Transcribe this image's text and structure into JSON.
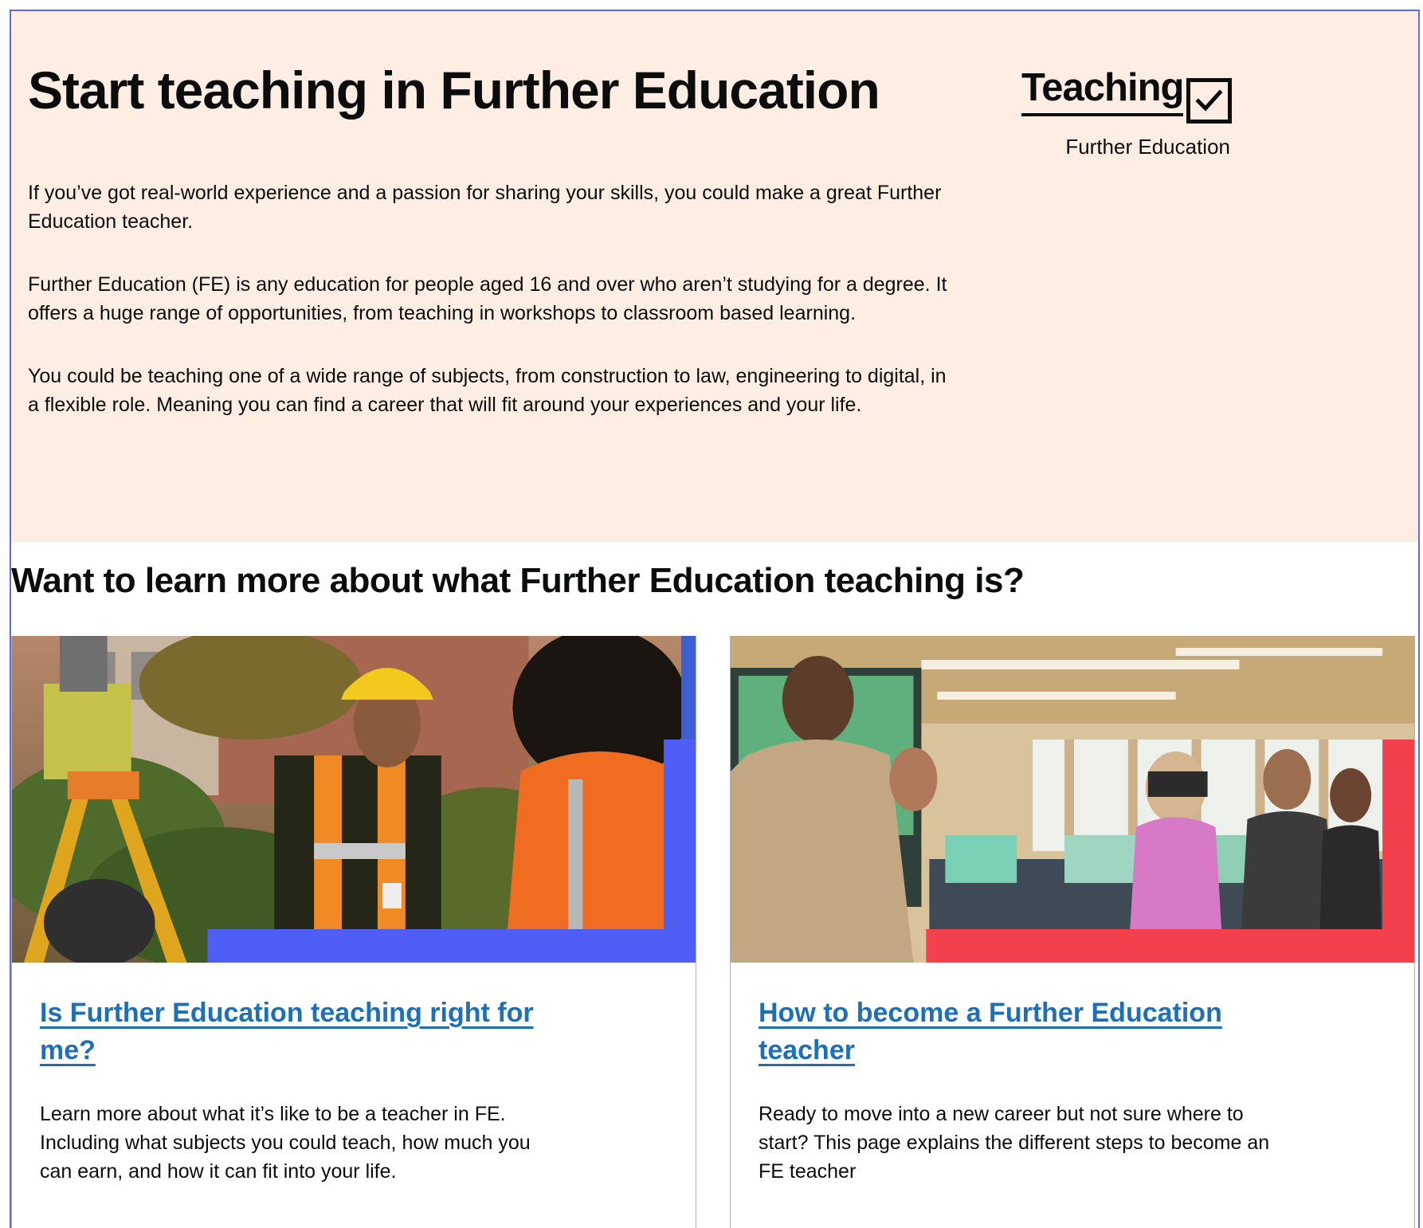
{
  "hero": {
    "title": "Start teaching in Further Education",
    "paragraphs": [
      "If you’ve got real-world experience and a passion for sharing your skills, you could make a great Further Education teacher.",
      "Further Education (FE) is any education for people aged 16 and over who aren’t studying for a degree. It offers a huge range of opportunities, from teaching in workshops to classroom based learning.",
      "You could be teaching one of a wide range of subjects, from construction to law, engineering to digital, in a flexible role. Meaning you can find a career that will fit around your experiences and your life."
    ],
    "background_color": "#fdede3"
  },
  "logo": {
    "word": "Teaching",
    "subtitle": "Further Education",
    "icon": "checkbox-tick-icon"
  },
  "section": {
    "title": "Want to learn more about what Further Education teaching is?"
  },
  "cards": [
    {
      "link": "Is Further Education teaching right for me?",
      "text": "Learn more about what it’s like to be a teacher in FE. Including what subjects you could teach, how much you can earn, and how it can fit into your life.",
      "accent_color": "#4f5ff5"
    },
    {
      "link": "How to become a Further Education teacher",
      "text": "Ready to move into a new career but not sure where to start? This page explains the different steps to become an FE teacher",
      "accent_color": "#f2404c"
    }
  ],
  "colors": {
    "link": "#1d70b8",
    "text": "#0b0c0c",
    "frame_border": "#5f6bd9"
  }
}
